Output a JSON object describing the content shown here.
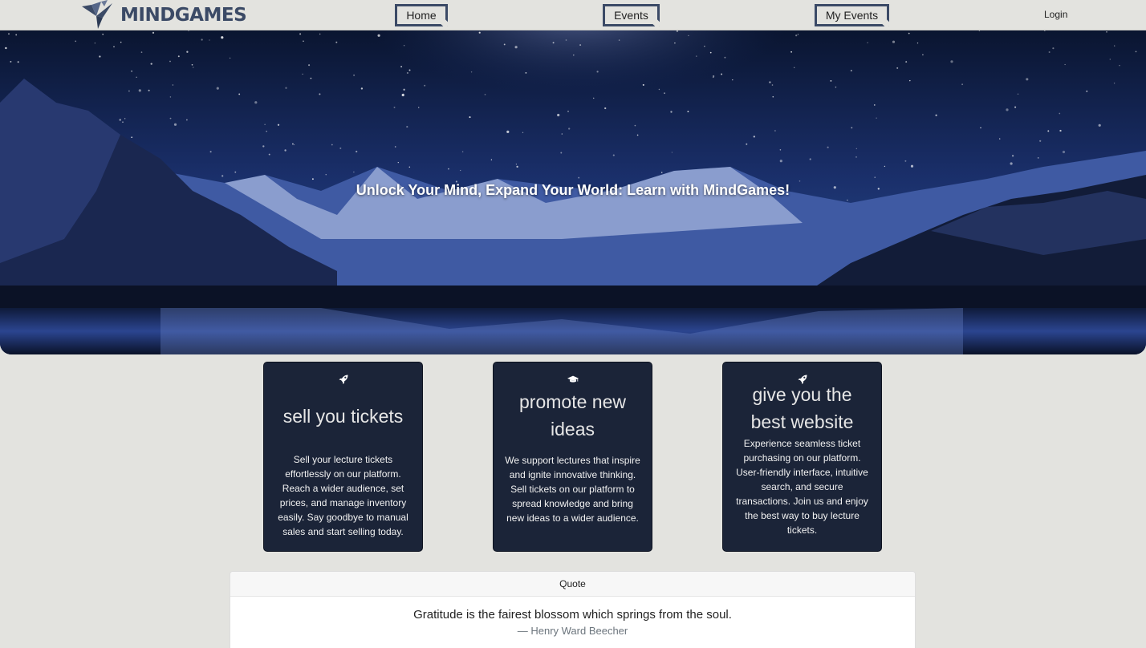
{
  "brand": {
    "name": "MINDGAMES",
    "logo_icon": "origami-bird-icon",
    "color": "#3b4a66"
  },
  "nav": {
    "home": "Home",
    "events": "Events",
    "my_events": "My Events",
    "login": "Login"
  },
  "hero": {
    "tagline": "Unlock Your Mind, Expand Your World: Learn with MindGames!"
  },
  "features": [
    {
      "icon": "rocket-icon",
      "title": "sell you tickets",
      "text": "Sell your lecture tickets effortlessly on our platform. Reach a wider audience, set prices, and manage inventory easily. Say goodbye to manual sales and start selling today."
    },
    {
      "icon": "graduation-cap-icon",
      "title": "promote new ideas",
      "text": "We support lectures that inspire and ignite innovative thinking. Sell tickets on our platform to spread knowledge and bring new ideas to a wider audience."
    },
    {
      "icon": "rocket-icon",
      "title": "give you the best website",
      "text": "Experience seamless ticket purchasing on our platform. User-friendly interface, intuitive search, and secure transactions. Join us and enjoy the best way to buy lecture tickets."
    }
  ],
  "quote": {
    "header": "Quote",
    "text": "Gratitude is the fairest blossom which springs from the soul.",
    "author": "— Henry Ward Beecher"
  },
  "colors": {
    "page_bg": "#e3e3df",
    "card_bg": "#1b2438",
    "accent": "#3b4a66"
  }
}
